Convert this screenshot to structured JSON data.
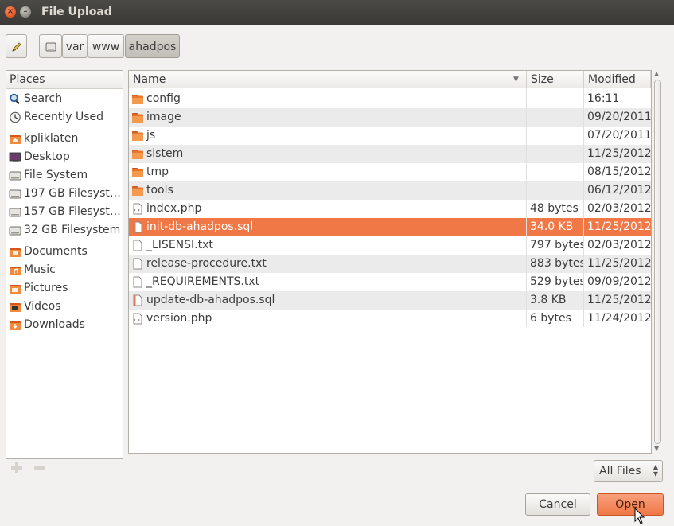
{
  "window": {
    "title": "File Upload"
  },
  "pathbar": {
    "segments": [
      "var",
      "www",
      "ahadpos"
    ],
    "active": "ahadpos"
  },
  "places": {
    "header": "Places",
    "items": [
      {
        "label": "Search",
        "icon": "search-icon"
      },
      {
        "label": "Recently Used",
        "icon": "clock-icon"
      },
      {
        "label": "kpliklaten",
        "icon": "home-folder-icon"
      },
      {
        "label": "Desktop",
        "icon": "desktop-icon"
      },
      {
        "label": "File System",
        "icon": "drive-icon"
      },
      {
        "label": "197 GB Filesyst…",
        "icon": "drive-icon"
      },
      {
        "label": "157 GB Filesyst…",
        "icon": "drive-icon"
      },
      {
        "label": "32 GB Filesystem",
        "icon": "drive-icon"
      },
      {
        "label": "Documents",
        "icon": "documents-folder-icon"
      },
      {
        "label": "Music",
        "icon": "music-folder-icon"
      },
      {
        "label": "Pictures",
        "icon": "pictures-folder-icon"
      },
      {
        "label": "Videos",
        "icon": "videos-folder-icon"
      },
      {
        "label": "Downloads",
        "icon": "downloads-folder-icon"
      }
    ]
  },
  "files": {
    "columns": {
      "name": "Name",
      "size": "Size",
      "modified": "Modified"
    },
    "rows": [
      {
        "name": "config",
        "size": "",
        "modified": "16:11",
        "type": "folder"
      },
      {
        "name": "image",
        "size": "",
        "modified": "09/20/2011",
        "type": "folder"
      },
      {
        "name": "js",
        "size": "",
        "modified": "07/20/2011",
        "type": "folder"
      },
      {
        "name": "sistem",
        "size": "",
        "modified": "11/25/2012",
        "type": "folder"
      },
      {
        "name": "tmp",
        "size": "",
        "modified": "08/15/2012",
        "type": "folder"
      },
      {
        "name": "tools",
        "size": "",
        "modified": "06/12/2012",
        "type": "folder"
      },
      {
        "name": "index.php",
        "size": "48 bytes",
        "modified": "02/03/2012",
        "type": "php"
      },
      {
        "name": "init-db-ahadpos.sql",
        "size": "34.0 KB",
        "modified": "11/25/2012",
        "type": "sql",
        "selected": true
      },
      {
        "name": "_LISENSI.txt",
        "size": "797 bytes",
        "modified": "02/03/2012",
        "type": "text"
      },
      {
        "name": "release-procedure.txt",
        "size": "883 bytes",
        "modified": "11/25/2012",
        "type": "text"
      },
      {
        "name": "_REQUIREMENTS.txt",
        "size": "529 bytes",
        "modified": "09/09/2012",
        "type": "text"
      },
      {
        "name": "update-db-ahadpos.sql",
        "size": "3.8 KB",
        "modified": "11/25/2012",
        "type": "sql"
      },
      {
        "name": "version.php",
        "size": "6 bytes",
        "modified": "11/24/2012",
        "type": "php"
      }
    ]
  },
  "filter": {
    "selected": "All Files"
  },
  "buttons": {
    "cancel": "Cancel",
    "open": "Open"
  },
  "colors": {
    "accent": "#f07746",
    "folder": "#e8772e"
  }
}
